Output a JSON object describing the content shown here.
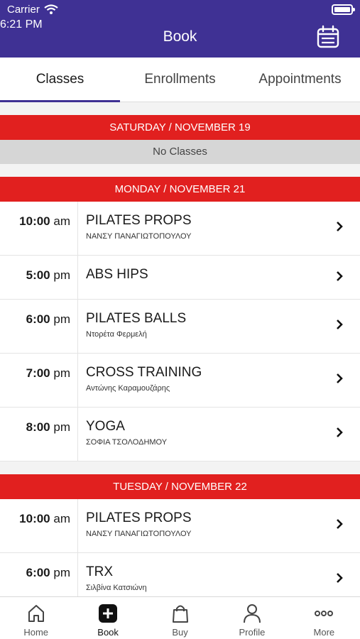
{
  "status": {
    "carrier": "Carrier",
    "time": "6:21 PM"
  },
  "nav": {
    "title": "Book"
  },
  "tabs": [
    {
      "label": "Classes"
    },
    {
      "label": "Enrollments"
    },
    {
      "label": "Appointments"
    }
  ],
  "days": [
    {
      "header": "SATURDAY / NOVEMBER 19",
      "empty": "No Classes"
    },
    {
      "header": "MONDAY / NOVEMBER 21",
      "classes": [
        {
          "time": "10:00",
          "ampm": "am",
          "name": "PILATES PROPS",
          "instructor": "ΝΑΝΣΥ ΠΑΝΑΓΙΩΤΟΠΟΥΛΟΥ"
        },
        {
          "time": "5:00",
          "ampm": "pm",
          "name": "ABS HIPS",
          "instructor": ""
        },
        {
          "time": "6:00",
          "ampm": "pm",
          "name": "PILATES BALLS",
          "instructor": "Ντορέτα Φερμελή"
        },
        {
          "time": "7:00",
          "ampm": "pm",
          "name": "CROSS TRAINING",
          "instructor": "Αντώνης Καραμουζάρης"
        },
        {
          "time": "8:00",
          "ampm": "pm",
          "name": "YOGA",
          "instructor": "ΣΟΦΙΑ ΤΣΟΛΟΔΗΜΟΥ"
        }
      ]
    },
    {
      "header": "TUESDAY / NOVEMBER 22",
      "classes": [
        {
          "time": "10:00",
          "ampm": "am",
          "name": "PILATES PROPS",
          "instructor": "ΝΑΝΣΥ ΠΑΝΑΓΙΩΤΟΠΟΥΛΟΥ"
        },
        {
          "time": "6:00",
          "ampm": "pm",
          "name": "TRX",
          "instructor": "Σιλβίνα Κατσιώνη"
        }
      ]
    }
  ],
  "tabbar": [
    {
      "label": "Home",
      "icon": "home-icon"
    },
    {
      "label": "Book",
      "icon": "plus-square-icon"
    },
    {
      "label": "Buy",
      "icon": "shopping-bag-icon"
    },
    {
      "label": "Profile",
      "icon": "user-icon"
    },
    {
      "label": "More",
      "icon": "more-dots-icon"
    }
  ],
  "colors": {
    "header": "#3f3194",
    "day_header": "#e1201f",
    "no_classes_bg": "#d6d6d6"
  }
}
